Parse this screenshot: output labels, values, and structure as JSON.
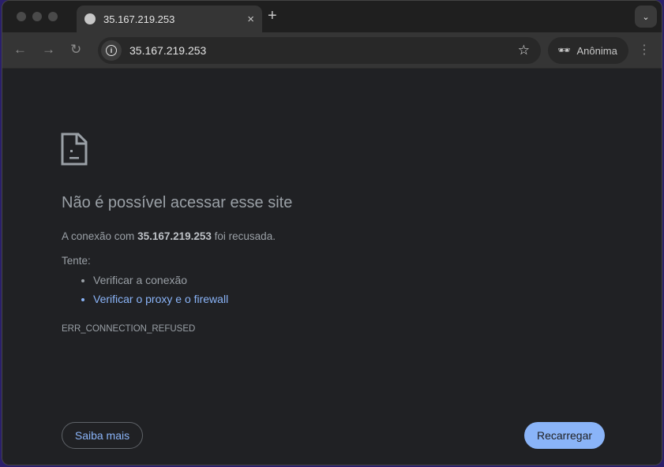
{
  "tab": {
    "title": "35.167.219.253",
    "close": "×",
    "new_tab": "+",
    "tab_search": "⌄"
  },
  "toolbar": {
    "back": "←",
    "forward": "→",
    "reload": "↻",
    "url": "35.167.219.253",
    "star": "☆",
    "profile": "Anônima",
    "menu": "⋮"
  },
  "error": {
    "heading": "Não é possível acessar esse site",
    "desc_prefix": "A conexão com ",
    "desc_host": "35.167.219.253",
    "desc_suffix": " foi recusada.",
    "try_label": "Tente:",
    "suggestions": [
      "Verificar a conexão",
      "Verificar o proxy e o firewall"
    ],
    "code": "ERR_CONNECTION_REFUSED"
  },
  "buttons": {
    "learn_more": "Saiba mais",
    "reload": "Recarregar"
  }
}
